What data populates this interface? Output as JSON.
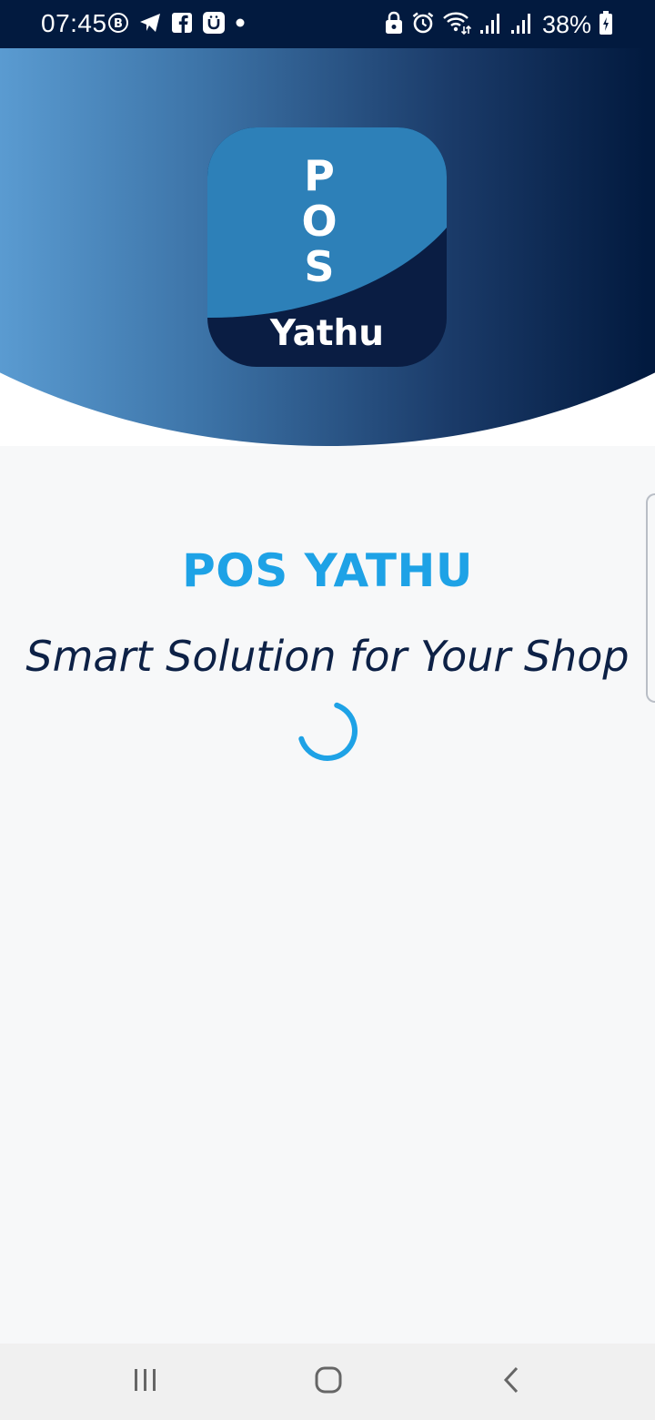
{
  "status_bar": {
    "time": "07:45",
    "battery_percent": "38%",
    "notification_icons": [
      "b-circle-icon",
      "telegram-icon",
      "facebook-icon",
      "u-app-icon",
      "dot-icon"
    ],
    "system_icons": [
      "lock-icon",
      "alarm-icon",
      "wifi-icon",
      "signal-icon",
      "signal-icon",
      "battery-charging-icon"
    ]
  },
  "logo": {
    "letters": "POS",
    "wordmark": "Yathu"
  },
  "app": {
    "title": "POS YATHU",
    "tagline": "Smart Solution for Your Shop"
  },
  "colors": {
    "status_bar_bg": "#021a3f",
    "title": "#1ea2e6",
    "tagline": "#0d2146",
    "spinner": "#1ea2e6"
  },
  "navigation": {
    "buttons": [
      "recent-apps",
      "home",
      "back"
    ]
  }
}
